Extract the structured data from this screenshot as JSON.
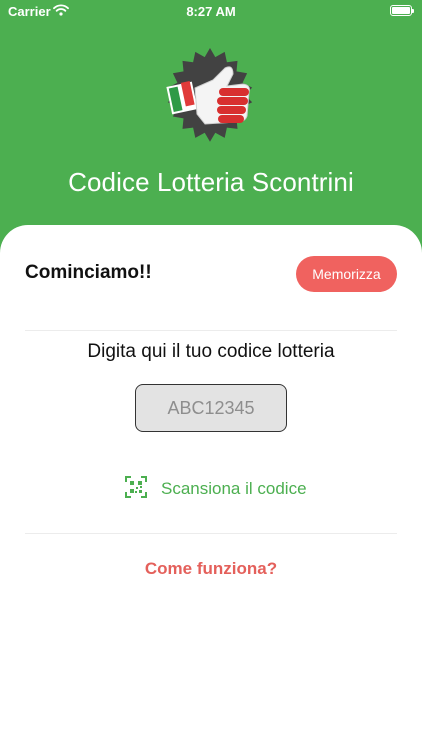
{
  "status_bar": {
    "carrier": "Carrier",
    "time": "8:27 AM",
    "wifi_icon": "wifi-icon",
    "battery_icon": "battery-icon"
  },
  "header": {
    "logo_icon": "thumbs-up-badge-icon",
    "title": "Codice Lotteria Scontrini",
    "background_color": "#4caf50"
  },
  "card": {
    "greeting": "Cominciamo!!",
    "save_label": "Memorizza",
    "prompt": "Digita qui il tuo codice lotteria",
    "code_input": {
      "value": "",
      "placeholder": "ABC12345"
    },
    "scan": {
      "icon": "qr-scan-icon",
      "label": "Scansiona il codice"
    },
    "how_link": "Come funziona?"
  },
  "colors": {
    "primary_green": "#4caf50",
    "accent_red": "#f0625f",
    "link_red": "#e4605b"
  }
}
